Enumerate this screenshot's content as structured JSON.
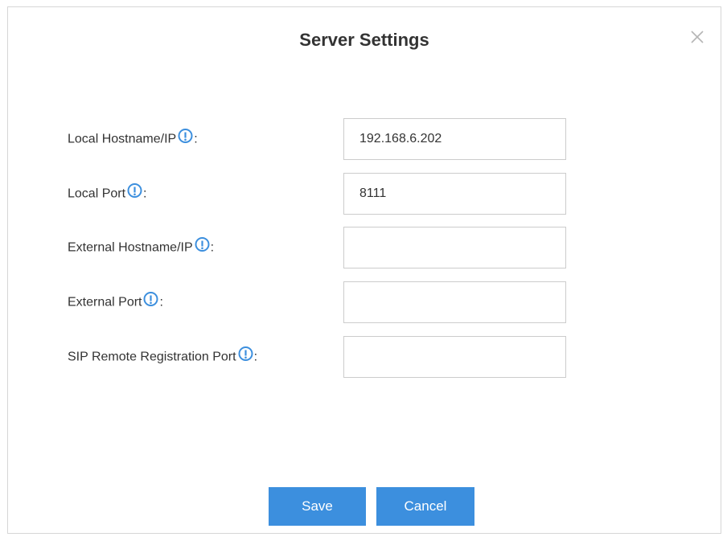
{
  "dialog": {
    "title": "Server Settings",
    "close_icon": "close-x-icon"
  },
  "fields": [
    {
      "label": "Local Hostname/IP",
      "colon": ":",
      "value": "192.168.6.202",
      "icon": "info-circle-icon"
    },
    {
      "label": "Local Port",
      "colon": ":",
      "value": "8111",
      "icon": "info-circle-icon"
    },
    {
      "label": "External Hostname/IP",
      "colon": ":",
      "value": "",
      "icon": "info-circle-icon"
    },
    {
      "label": "External Port",
      "colon": ":",
      "value": "",
      "icon": "info-circle-icon"
    },
    {
      "label": "SIP Remote Registration Port",
      "colon": ":",
      "value": "",
      "icon": "info-circle-icon"
    }
  ],
  "buttons": {
    "save_label": "Save",
    "cancel_label": "Cancel"
  },
  "colors": {
    "accent": "#3c8fde",
    "info_icon": "#3c8fde",
    "text": "#333333",
    "border": "#cccccc"
  }
}
